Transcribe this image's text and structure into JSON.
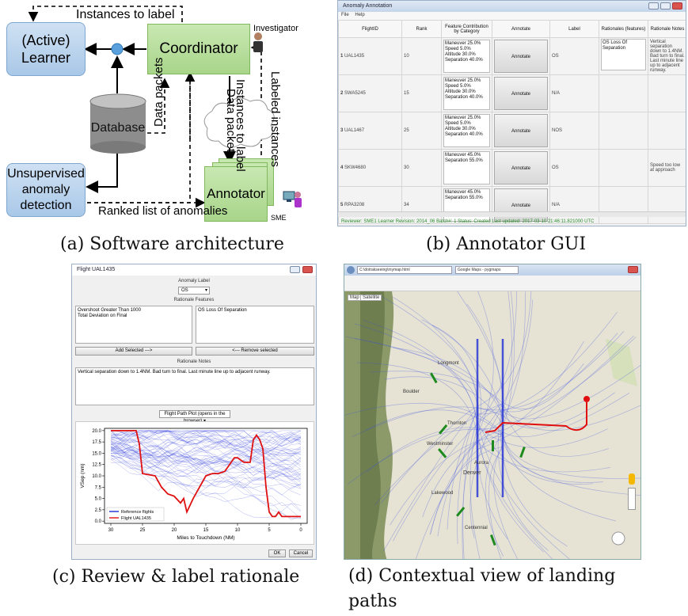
{
  "captions": {
    "a": "(a) Software architecture",
    "b": "(b) Annotator GUI",
    "c": "(c) Review & label rationale",
    "d": "(d)  Contextual  view  of  landing paths"
  },
  "arch": {
    "learner_line1": "(Active)",
    "learner_line2": "Learner",
    "coordinator": "Coordinator",
    "database": "Database",
    "unsup_line1": "Unsupervised",
    "unsup_line2": "anomaly",
    "unsup_line3": "detection",
    "annotator": "Annotator",
    "instances_to_label_top": "Instances to label",
    "data_packets_left": "Data packets",
    "instances_to_label_vert": "Instances to label",
    "data_packets_vert": "Data packets",
    "labeled_instances": "Labeled instances",
    "ranked_list": "Ranked list of anomalies",
    "investigator": "Investigator",
    "sme": "SME"
  },
  "gui": {
    "title": "Anomaly Annotation",
    "menu": [
      "File",
      "Help"
    ],
    "headers": [
      "FlightID",
      "Rank",
      "Feature Contribution by Category",
      "Annotate",
      "Label",
      "Rationales (features)",
      "Rationale Notes"
    ],
    "rows": [
      {
        "idx": "1",
        "id": "UAL1435",
        "rank": "10",
        "feat": [
          "Maneuver 25.0%",
          "Speed 5.0%",
          "Altitude 30.0%",
          "Separation 40.0%"
        ],
        "btn": "Annotate",
        "label": "OS",
        "rat": "OS Loss Of Separation",
        "notes": "Vertical separation down to 1.4NM. Bad turn to final. Last minute line up to adjacent runway."
      },
      {
        "idx": "2",
        "id": "SWA5245",
        "rank": "15",
        "feat": [
          "Maneuver 25.0%",
          "Speed 5.0%",
          "Altitude 30.0%",
          "Separation 40.0%"
        ],
        "btn": "Annotate",
        "label": "N/A",
        "rat": "",
        "notes": ""
      },
      {
        "idx": "3",
        "id": "UAL1467",
        "rank": "25",
        "feat": [
          "Maneuver 25.0%",
          "Speed 5.0%",
          "Altitude 30.0%",
          "Separation 40.0%"
        ],
        "btn": "Annotate",
        "label": "NOS",
        "rat": "",
        "notes": ""
      },
      {
        "idx": "4",
        "id": "SKW4680",
        "rank": "30",
        "feat": [
          "Maneuver 45.0%",
          "Separation 55.0%"
        ],
        "btn": "Annotate",
        "label": "OS",
        "rat": "",
        "notes": "Speed too low at approach"
      },
      {
        "idx": "5",
        "id": "RPA3208",
        "rank": "34",
        "feat": [
          "Maneuver 45.0%",
          "Separation 55.0%"
        ],
        "btn": "Annotate",
        "label": "N/A",
        "rat": "",
        "notes": ""
      }
    ],
    "status": "Reviewer: SME1   Learner Revision: 2014_06   Batch#: 1   Status: Created   Last updated: 2017-03-10 21:46:11.821000 UTC"
  },
  "review": {
    "title": "Flight UAL1435",
    "anomaly_label": "Anomaly Label",
    "selected_label": "OS",
    "rationale_features": "Rationale Features",
    "left_list": [
      "Overshoot Greater Than 1000",
      "Total Deviation on Final"
    ],
    "right_list": [
      "OS Loss Of Separation"
    ],
    "add_btn": "Add Selected --->",
    "remove_btn": "<--- Remove selected",
    "rationale_notes": "Rationale Notes",
    "notes_text": "Vertical separation down to 1.4NM. Bad turn to final. Last minute line up to adjacent runway.",
    "plot_select": "Flight Path Plot (opens in the browser)",
    "ok": "OK",
    "cancel": "Cancel"
  },
  "chart_data": {
    "type": "line",
    "xlabel": "Miles to Touchdown (NM)",
    "ylabel": "VSep (nm)",
    "xlim": [
      31,
      -1
    ],
    "ylim": [
      -0.5,
      20.5
    ],
    "xticks": [
      30,
      25,
      20,
      15,
      10,
      5,
      0
    ],
    "yticks": [
      0.0,
      2.5,
      5.0,
      7.5,
      10.0,
      12.5,
      15.0,
      17.5,
      20.0
    ],
    "legend_position": "lower-left",
    "series": [
      {
        "name": "Reference flights",
        "color": "#1f2dd6",
        "values": []
      },
      {
        "name": "Flight UAL1435",
        "color": "#e01010",
        "x": [
          30,
          26,
          25.5,
          25,
          23,
          22,
          21,
          20,
          19,
          18.5,
          18,
          17,
          16,
          15,
          14,
          13,
          12,
          11,
          10.5,
          10,
          9,
          8,
          7.5,
          7,
          6.5,
          6,
          5.5,
          5,
          4.5,
          4,
          3.5,
          3,
          2.5,
          2,
          1.5,
          1,
          0.5,
          0
        ],
        "y": [
          20,
          20,
          17,
          10.5,
          10,
          7.5,
          6,
          5.5,
          4,
          5,
          2,
          5,
          7.5,
          10,
          10.5,
          10.5,
          11,
          13,
          14,
          14,
          13,
          13,
          18,
          19,
          18,
          16,
          7.5,
          2,
          1,
          1,
          2,
          1,
          1,
          1,
          1,
          1,
          1,
          1
        ]
      }
    ]
  },
  "browser": {
    "url": "C:\\dotrakseeing\\mymap.html",
    "tab": "Google Maps - pygmaps",
    "map_tab": "Map",
    "sat_tab": "Satellite",
    "places": [
      "Longmont",
      "Boulder",
      "Thornton",
      "Westminster",
      "Denver",
      "Aurora",
      "Lakewood",
      "Centennial"
    ]
  }
}
